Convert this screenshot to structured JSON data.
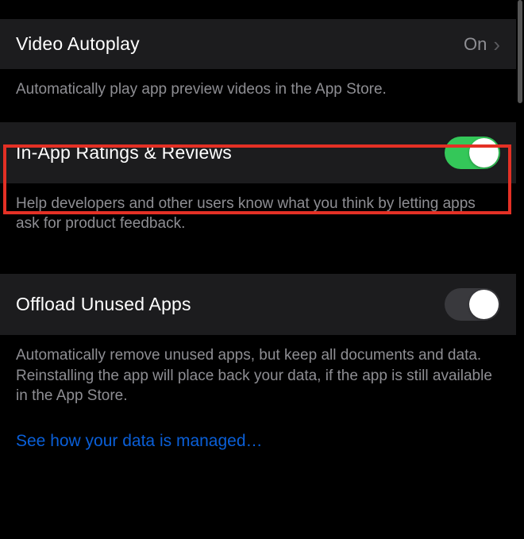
{
  "rows": {
    "video_autoplay": {
      "label": "Video Autoplay",
      "value": "On",
      "description": "Automatically play app preview videos in the App Store."
    },
    "in_app_ratings": {
      "label": "In-App Ratings & Reviews",
      "description": "Help developers and other users know what you think by letting apps ask for product feedback."
    },
    "offload_unused": {
      "label": "Offload Unused Apps",
      "description": "Automatically remove unused apps, but keep all documents and data. Reinstalling the app will place back your data, if the app is still available in the App Store."
    }
  },
  "link": {
    "label": "See how your data is managed…"
  }
}
